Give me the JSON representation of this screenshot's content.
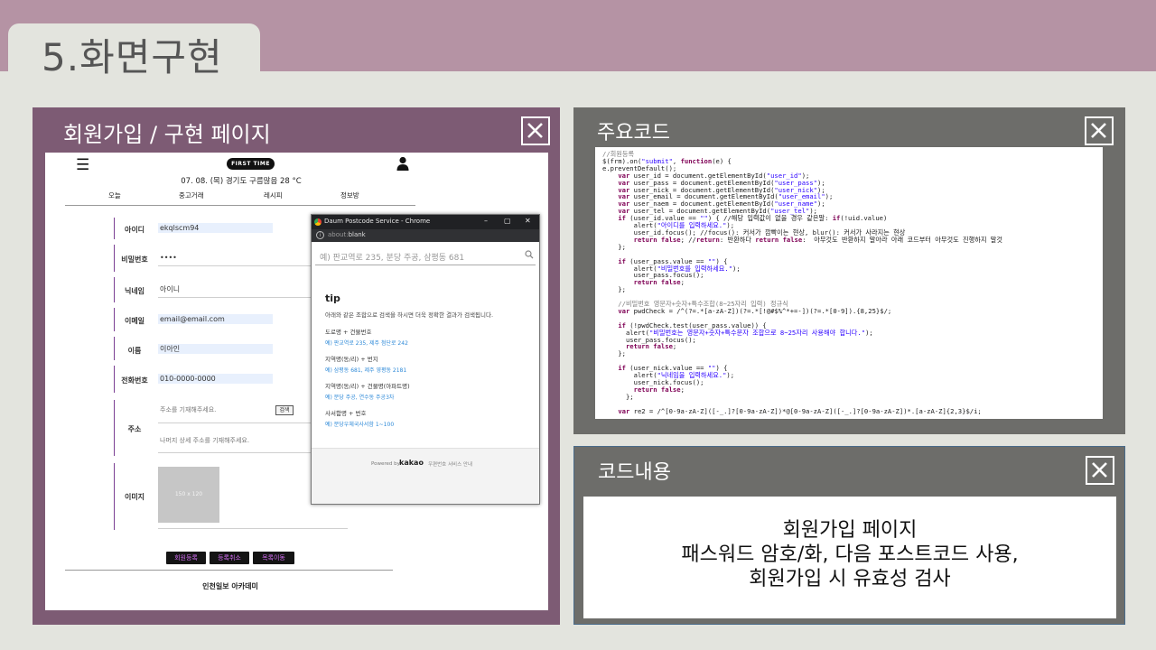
{
  "slide": {
    "title": "5.화면구현"
  },
  "left_panel": {
    "title": "회원가입 / 구현 페이지",
    "site": {
      "logo": "FIRST TIME",
      "weather": "07. 08. (목)  경기도 구름많음 28 °C",
      "nav": [
        "오늘",
        "중고거래",
        "레시피",
        "정보방"
      ],
      "form": {
        "id_label": "아이디",
        "id_value": "ekqlscm94",
        "pw_label": "비밀번호",
        "pw_value": "••••",
        "nick_label": "닉네임",
        "nick_value": "아이니",
        "email_label": "이메일",
        "email_value": "email@email.com",
        "name_label": "이름",
        "name_value": "이아인",
        "tel_label": "전화번호",
        "tel_value": "010-0000-0000",
        "addr_label": "주소",
        "addr_placeholder": "주소를 기재해주세요.",
        "addr_search": "검색",
        "addr_detail_placeholder": "나머지 상세 주소를 기재해주세요.",
        "image_label": "이미지",
        "image_placeholder": "150 x 120"
      },
      "buttons": [
        "회원등록",
        "등록취소",
        "목록이동"
      ],
      "footer": "인천일보 아카데미"
    },
    "popup": {
      "window_title": "Daum Postcode Service - Chrome",
      "window_controls": [
        "–",
        "▢",
        "✕"
      ],
      "url_prefix": "about:",
      "url_main": "blank",
      "search_placeholder": "예) 판교역로 235, 분당 주공, 삼평동 681",
      "tip_heading": "tip",
      "tip_desc": "아래와 같은 조합으로 검색을 하시면 더욱 정확한 결과가 검색됩니다.",
      "tips": [
        {
          "label": "도로명 + 건물번호",
          "example": "예) 판교역로 235,  제주 첨단로 242"
        },
        {
          "label": "지역명(동/리) + 번지",
          "example": "예) 삼평동 681,  제주 영평동 2181"
        },
        {
          "label": "지역명(동/리) + 건물명(아파트명)",
          "example": "예) 분당 주공,  연수동 주공3차"
        },
        {
          "label": "사서함명 + 번호",
          "example": "예) 분당우체국사서함 1~100"
        }
      ],
      "powered_by": "Powered by",
      "kakao": "kakao",
      "postcode_guide": "우편번호 서비스 안내"
    }
  },
  "code_panel": {
    "title": "주요코드",
    "lines": [
      {
        "t": "//회원등록",
        "c": "cm"
      },
      {
        "t": "$(frm).on(\"submit\", function(e) {",
        "c": ""
      },
      {
        "t": "e.preventDefault();",
        "c": ""
      },
      {
        "t": "    var user_id = document.getElementById(\"user_id\");",
        "c": ""
      },
      {
        "t": "    var user_pass = document.getElementById(\"user_pass\");",
        "c": ""
      },
      {
        "t": "    var user_nick = document.getElementById(\"user_nick\");",
        "c": ""
      },
      {
        "t": "    var user_email = document.getElementById(\"user_email\");",
        "c": ""
      },
      {
        "t": "    var user_naem = document.getElementById(\"user_name\");",
        "c": ""
      },
      {
        "t": "    var user_tel = document.getElementById(\"user_tel\");",
        "c": ""
      },
      {
        "t": "    if (user_id.value == \"\") { //해당 입력값이 없을 경우 같은말: if(!uid.value)",
        "c": ""
      },
      {
        "t": "        alert(\"아이디를 입력하세요.\");",
        "c": ""
      },
      {
        "t": "        user_id.focus(); //focus(): 커서가 깜빡이는 현상, blur(): 커서가 사라지는 현상",
        "c": ""
      },
      {
        "t": "        return false; //return: 반환하다 return false:  아무것도 반환하지 말아라 아래 코드부터 아무것도 진행하지 말것",
        "c": ""
      },
      {
        "t": "    };",
        "c": ""
      },
      {
        "t": "",
        "c": ""
      },
      {
        "t": "    if (user_pass.value == \"\") {",
        "c": ""
      },
      {
        "t": "        alert(\"비밀번호를 입력하세요.\");",
        "c": ""
      },
      {
        "t": "        user_pass.focus();",
        "c": ""
      },
      {
        "t": "        return false;",
        "c": ""
      },
      {
        "t": "    };",
        "c": ""
      },
      {
        "t": "",
        "c": ""
      },
      {
        "t": "    //비밀번호 영문자+숫자+특수조합(8~25자리 입력) 정규식",
        "c": "cm"
      },
      {
        "t": "    var pwdCheck = /^(?=.*[a-zA-Z])(?=.*[!@#$%^*+=-])(?=.*[0-9]).{8,25}$/;",
        "c": ""
      },
      {
        "t": "",
        "c": ""
      },
      {
        "t": "    if (!pwdCheck.test(user_pass.value)) {",
        "c": ""
      },
      {
        "t": "      alert(\"비밀번호는 영문자+숫자+특수문자 조합으로 8~25자리 사용해야 합니다.\");",
        "c": ""
      },
      {
        "t": "      user_pass.focus();",
        "c": ""
      },
      {
        "t": "      return false;",
        "c": ""
      },
      {
        "t": "    };",
        "c": ""
      },
      {
        "t": "",
        "c": ""
      },
      {
        "t": "    if (user_nick.value == \"\") {",
        "c": ""
      },
      {
        "t": "        alert(\"닉네임을 입력하세요.\");",
        "c": ""
      },
      {
        "t": "        user_nick.focus();",
        "c": ""
      },
      {
        "t": "        return false;",
        "c": ""
      },
      {
        "t": "      };",
        "c": ""
      },
      {
        "t": "",
        "c": ""
      },
      {
        "t": "    var re2 = /^[0-9a-zA-Z]([-_.]?[0-9a-zA-Z])*@[0-9a-zA-Z]([-_.]?[0-9a-zA-Z])*.[a-zA-Z]{2,3}$/i;",
        "c": ""
      }
    ]
  },
  "desc_panel": {
    "title": "코드내용",
    "lines": [
      "회원가입 페이지",
      "패스워드 암호/화, 다음 포스트코드 사용,",
      "회원가입 시 유효성 검사"
    ]
  }
}
